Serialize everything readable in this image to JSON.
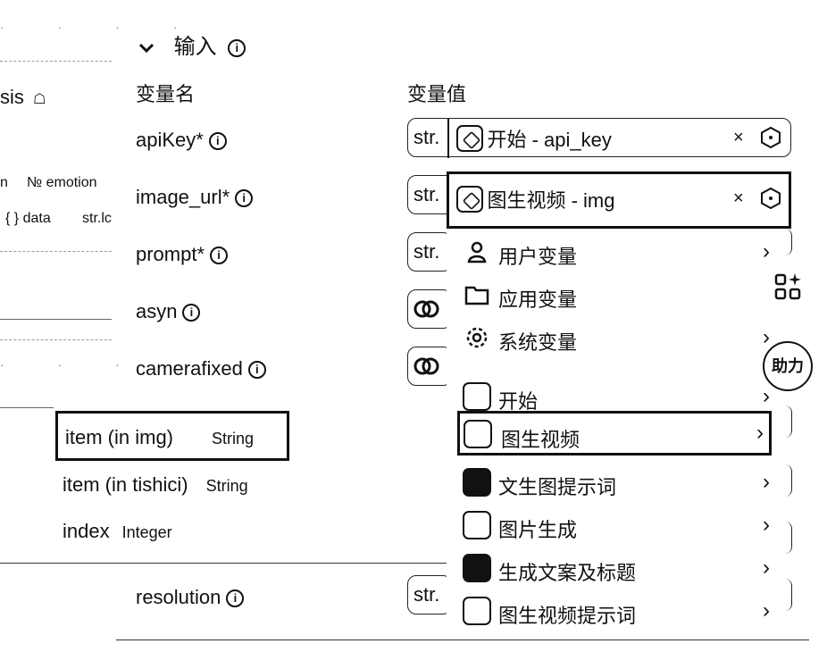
{
  "section": {
    "title": "输入",
    "chevron": "chevron-down"
  },
  "columns": {
    "name": "变量名",
    "value": "变量值"
  },
  "left_panel": {
    "fragment_title": "sis",
    "tag_emotion": "№ emotion",
    "tag_data": "{ } data",
    "tag_str": "str.lc",
    "tag_n": "n"
  },
  "variables": [
    {
      "name": "apiKey*",
      "type": "str.",
      "value": "开始 - api_key"
    },
    {
      "name": "image_url*",
      "type": "str.",
      "value": "图生视频 - img"
    },
    {
      "name": "prompt*",
      "type": "str."
    },
    {
      "name": "asyn",
      "type": "toggle"
    },
    {
      "name": "camerafixed",
      "type": "toggle"
    },
    {
      "name": "resolution",
      "type": "str."
    }
  ],
  "suggestions": [
    {
      "name": "item (in img)",
      "type": "String"
    },
    {
      "name": "item (in tishici)",
      "type": "String"
    },
    {
      "name": "index",
      "type": "Integer"
    }
  ],
  "menu": {
    "items": [
      {
        "label": "用户变量",
        "icon": "user-icon"
      },
      {
        "label": "应用变量",
        "icon": "folder-icon"
      },
      {
        "label": "系统变量",
        "icon": "gear-icon"
      },
      {
        "label": "开始",
        "icon": "start-node-icon"
      },
      {
        "label": "图生视频",
        "icon": "image-to-video-node-icon"
      },
      {
        "label": "文生图提示词",
        "icon": "llm-node-icon"
      },
      {
        "label": "图片生成",
        "icon": "image-gen-node-icon"
      },
      {
        "label": "生成文案及标题",
        "icon": "llm-node-icon"
      },
      {
        "label": "图生视频提示词",
        "icon": "image-to-video-node-icon"
      }
    ]
  },
  "side_badge": "助力"
}
